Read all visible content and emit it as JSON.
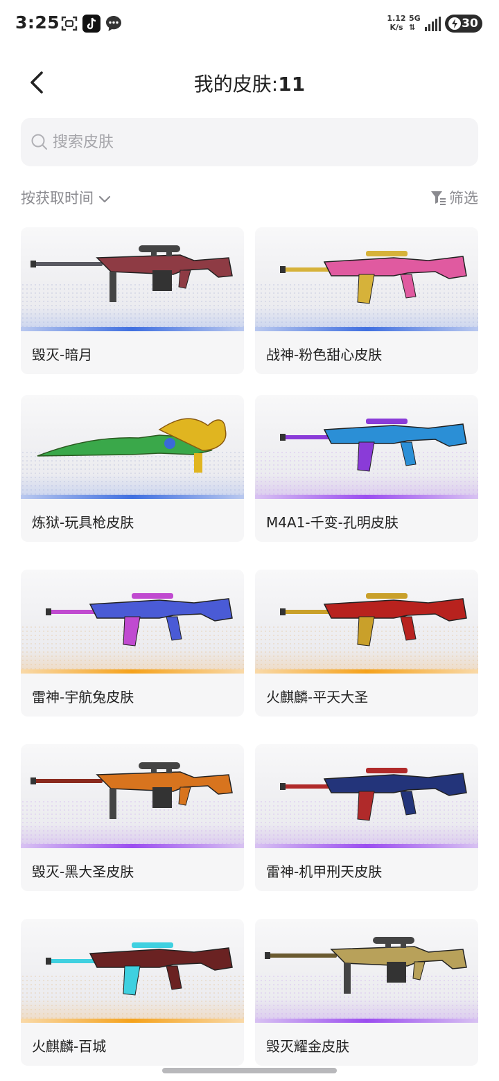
{
  "status_bar": {
    "time": "3:25",
    "net_speed_value": "1.12",
    "net_speed_unit": "K/s",
    "network_type": "5G",
    "battery": "30"
  },
  "header": {
    "title_prefix": "我的皮肤:",
    "title_count": "11"
  },
  "search": {
    "placeholder": "搜索皮肤"
  },
  "toolbar": {
    "sort_label": "按获取时间",
    "filter_label": "筛选"
  },
  "skins": [
    {
      "name": "毁灭-暗月",
      "rarity": "blue",
      "icon": "sniper-rifle-icon",
      "colors": [
        "#8e3b44",
        "#5a5a62"
      ]
    },
    {
      "name": "战神-粉色甜心皮肤",
      "rarity": "blue",
      "icon": "assault-rifle-icon",
      "colors": [
        "#e05aa0",
        "#d6b23a"
      ]
    },
    {
      "name": "炼狱-玩具枪皮肤",
      "rarity": "blue",
      "icon": "dragon-rifle-icon",
      "colors": [
        "#3aa84a",
        "#e0b520"
      ]
    },
    {
      "name": "M4A1-千变-孔明皮肤",
      "rarity": "purple",
      "icon": "assault-rifle-icon",
      "colors": [
        "#2b8fd6",
        "#8a3bd8"
      ]
    },
    {
      "name": "雷神-宇航兔皮肤",
      "rarity": "orange",
      "icon": "assault-rifle-icon",
      "colors": [
        "#4a5bd6",
        "#c04ad0"
      ]
    },
    {
      "name": "火麒麟-平天大圣",
      "rarity": "orange",
      "icon": "assault-rifle-icon",
      "colors": [
        "#b8221e",
        "#c9a02a"
      ]
    },
    {
      "name": "毁灭-黑大圣皮肤",
      "rarity": "purple",
      "icon": "sniper-rifle-icon",
      "colors": [
        "#d8741e",
        "#8a2a1e"
      ]
    },
    {
      "name": "雷神-机甲刑天皮肤",
      "rarity": "purple",
      "icon": "assault-rifle-icon",
      "colors": [
        "#23347a",
        "#b02a2a"
      ]
    },
    {
      "name": "火麒麟-百城",
      "rarity": "orange",
      "icon": "assault-rifle-icon",
      "colors": [
        "#6a2222",
        "#3fd0e0"
      ]
    },
    {
      "name": "毁灭耀金皮肤",
      "rarity": "purple",
      "icon": "sniper-rifle-icon",
      "colors": [
        "#b8a15a",
        "#6a5a30"
      ]
    }
  ]
}
